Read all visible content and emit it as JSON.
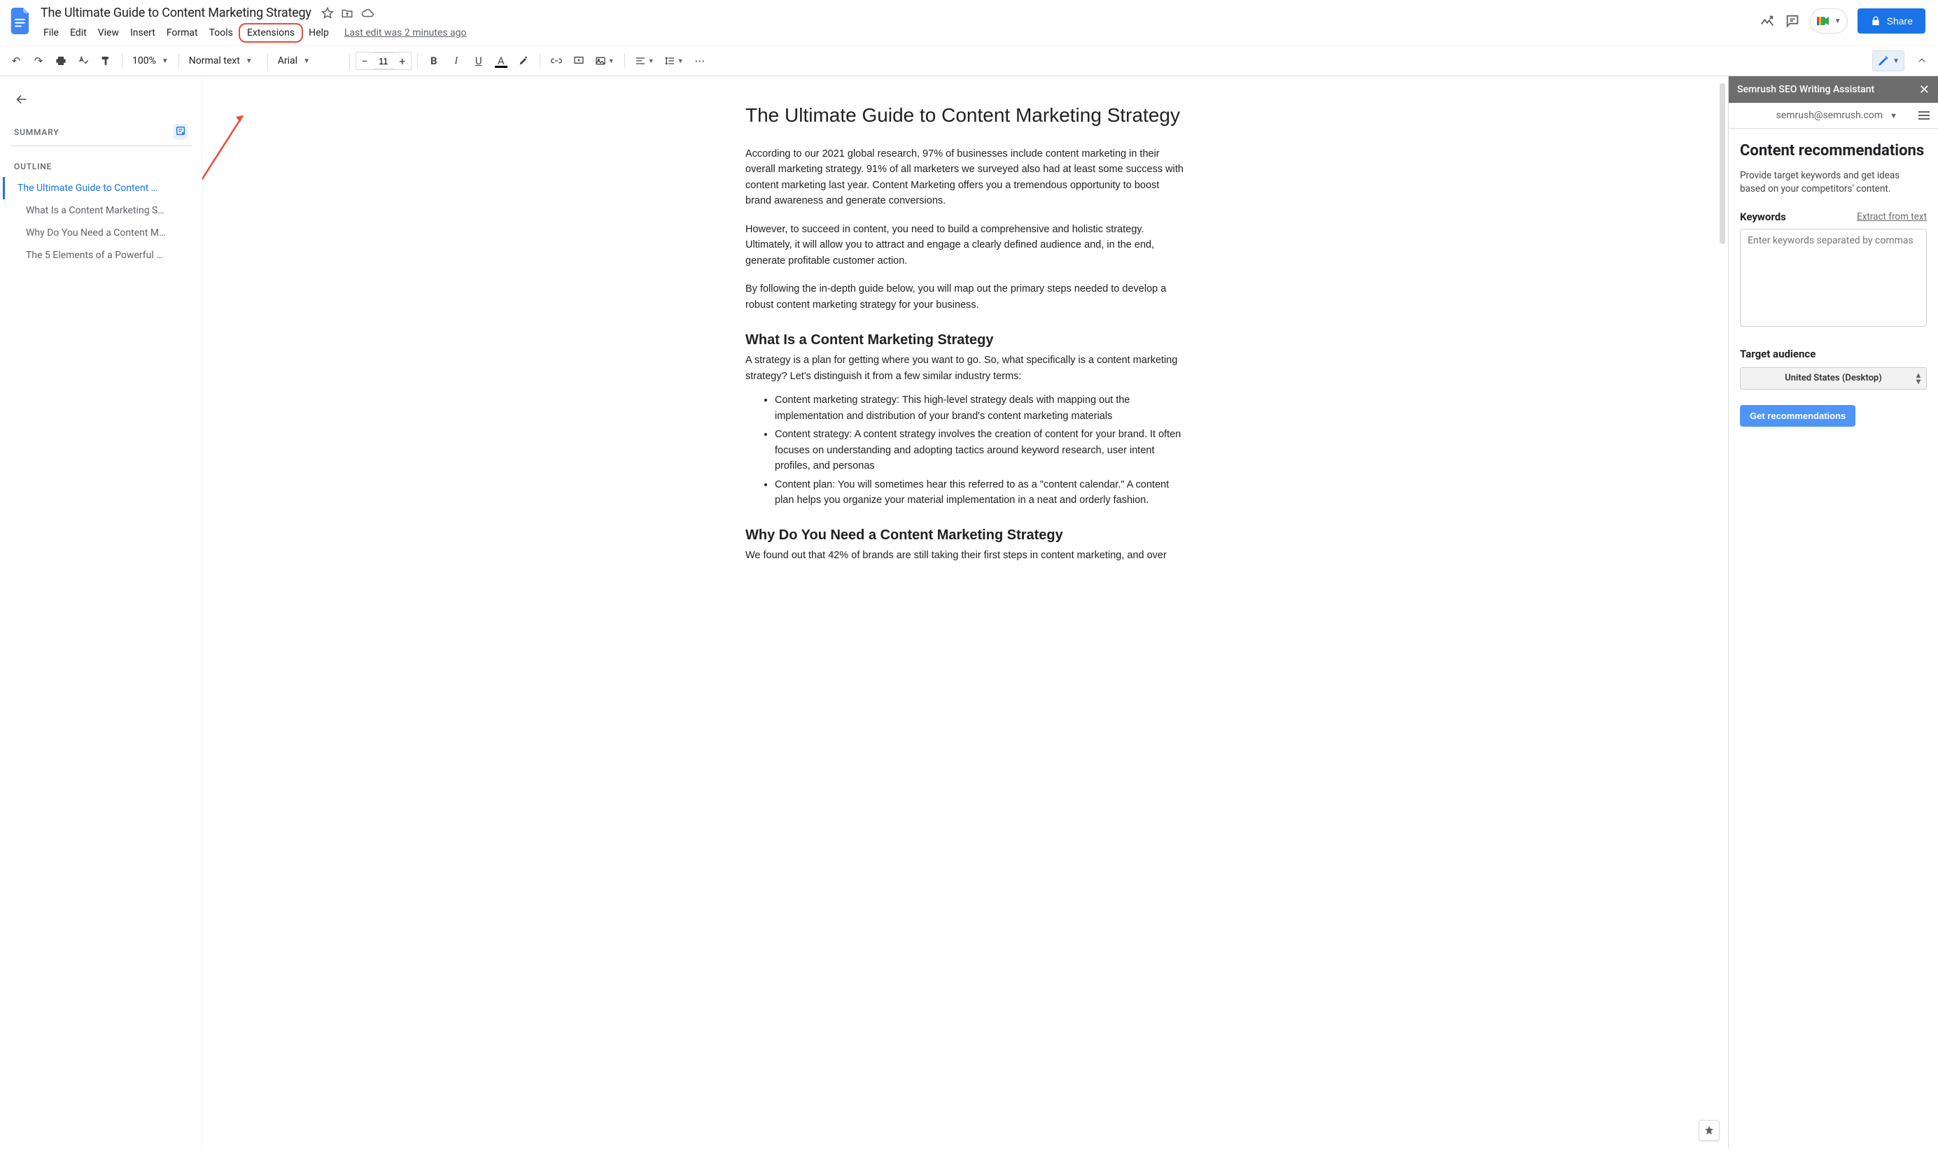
{
  "doc": {
    "title": "The Ultimate Guide to Content Marketing Strategy",
    "last_edit": "Last edit was 2 minutes ago"
  },
  "menus": {
    "file": "File",
    "edit": "Edit",
    "view": "View",
    "insert": "Insert",
    "format": "Format",
    "tools": "Tools",
    "extensions": "Extensions",
    "help": "Help"
  },
  "share": {
    "label": "Share"
  },
  "toolbar": {
    "zoom": "100%",
    "style": "Normal text",
    "font": "Arial",
    "fontsize": "11"
  },
  "outline": {
    "summary_label": "SUMMARY",
    "outline_label": "OUTLINE",
    "items": [
      "The Ultimate Guide to Content …",
      "What Is a Content Marketing S…",
      "Why Do You Need a Content M…",
      "The 5 Elements of a Powerful …"
    ]
  },
  "content": {
    "h1": "The Ultimate Guide to Content Marketing Strategy",
    "p1": "According to our 2021 global research, 97% of businesses include content marketing in their overall marketing strategy. 91% of all marketers we surveyed also had at least some success with content marketing last year. Content Marketing offers you a tremendous opportunity to boost brand awareness and generate conversions.",
    "p2": "However, to succeed in content, you need to build a comprehensive and holistic strategy. Ultimately, it will allow you to attract and engage a clearly defined audience and, in the end, generate profitable customer action.",
    "p3": "By following the in-depth guide below, you will map out the primary steps needed to develop a robust content marketing strategy for your business.",
    "h2a": "What Is a Content Marketing Strategy",
    "p4": "A strategy is a plan for getting where you want to go. So, what specifically is a content marketing strategy? Let's distinguish it from a few similar industry terms:",
    "li1": "Content marketing strategy: This high-level strategy deals with mapping out the implementation and distribution of your brand's content marketing materials",
    "li2": "Content strategy: A content strategy involves the creation of content for your brand. It often focuses on understanding and adopting tactics around keyword research, user intent profiles, and personas",
    "li3": "Content plan: You will sometimes hear this referred to as a \"content calendar.\" A content plan helps you organize your material implementation in a neat and orderly fashion.",
    "h2b": "Why Do You Need a Content Marketing Strategy",
    "p5": "We found out that 42% of brands are still taking their first steps in content marketing, and over"
  },
  "panel": {
    "title": "Semrush SEO Writing Assistant",
    "user_email": "semrush@semrush.com",
    "heading": "Content recommendations",
    "desc": "Provide target keywords and get ideas based on your competitors' content.",
    "keywords_label": "Keywords",
    "extract_link": "Extract from text",
    "kw_placeholder": "Enter keywords separated by commas",
    "target_audience_label": "Target audience",
    "audience_value": "United States (Desktop)",
    "get_btn": "Get recommendations"
  }
}
